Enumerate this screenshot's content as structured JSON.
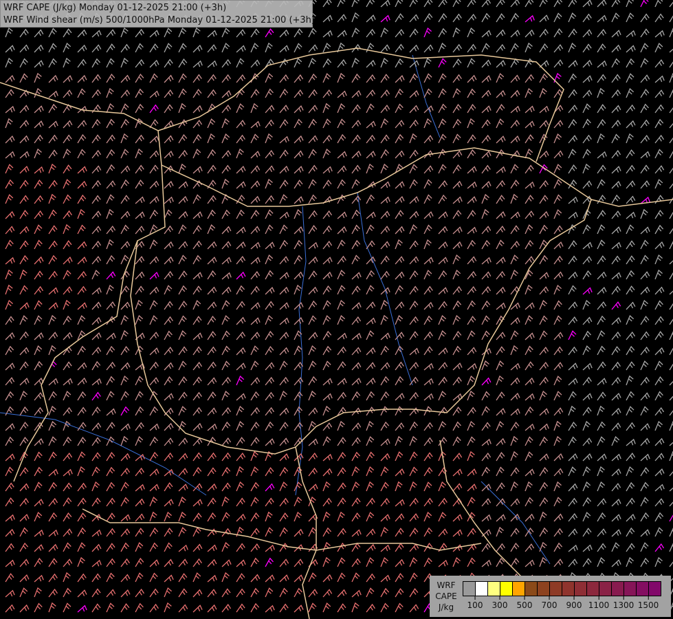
{
  "header": {
    "line1": "WRF CAPE (J/kg) Monday 01-12-2025 21:00 (+3h)",
    "line2": "WRF Wind shear (m/s) 500/1000hPa Monday 01-12-2025 21:00 (+3h)"
  },
  "legend": {
    "label_line1": "WRF",
    "label_line2": "CAPE",
    "label_line3": "J/kg",
    "colors": [
      "#9a9a9a",
      "#ffffff",
      "#ffff80",
      "#ffff00",
      "#ffa500",
      "#8b4a19",
      "#8d421f",
      "#8e3b26",
      "#8f342d",
      "#8e2e35",
      "#8c283d",
      "#8a2246",
      "#881b4f",
      "#861558",
      "#840e61",
      "#82086a"
    ],
    "ticks": [
      "100",
      "300",
      "500",
      "700",
      "900",
      "1100",
      "1300",
      "1500"
    ]
  },
  "map_colors": {
    "background": "#000000",
    "border": "#e8c89a",
    "river": "#3a6fd8",
    "barb_low": "#a8a8a8",
    "barb_mid": "#c89090",
    "barb_high": "#e87070",
    "barb_extreme": "#ff00ff"
  }
}
